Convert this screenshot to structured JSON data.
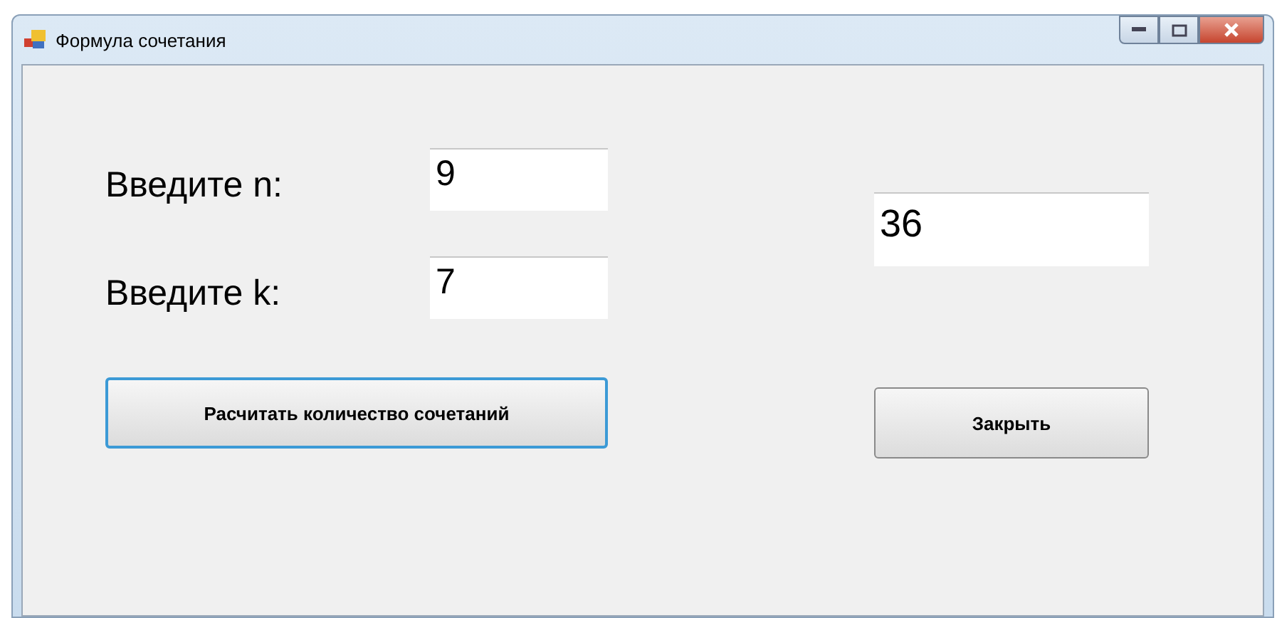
{
  "window": {
    "title": "Формула сочетания"
  },
  "inputs": [
    {
      "label": "Введите n:",
      "value": "9"
    },
    {
      "label": "Введите k:",
      "value": "7"
    }
  ],
  "result": {
    "value": "36"
  },
  "buttons": [
    {
      "label": "Расчитать количество сочетаний",
      "focused": true
    },
    {
      "label": "Закрыть",
      "focused": false
    }
  ]
}
